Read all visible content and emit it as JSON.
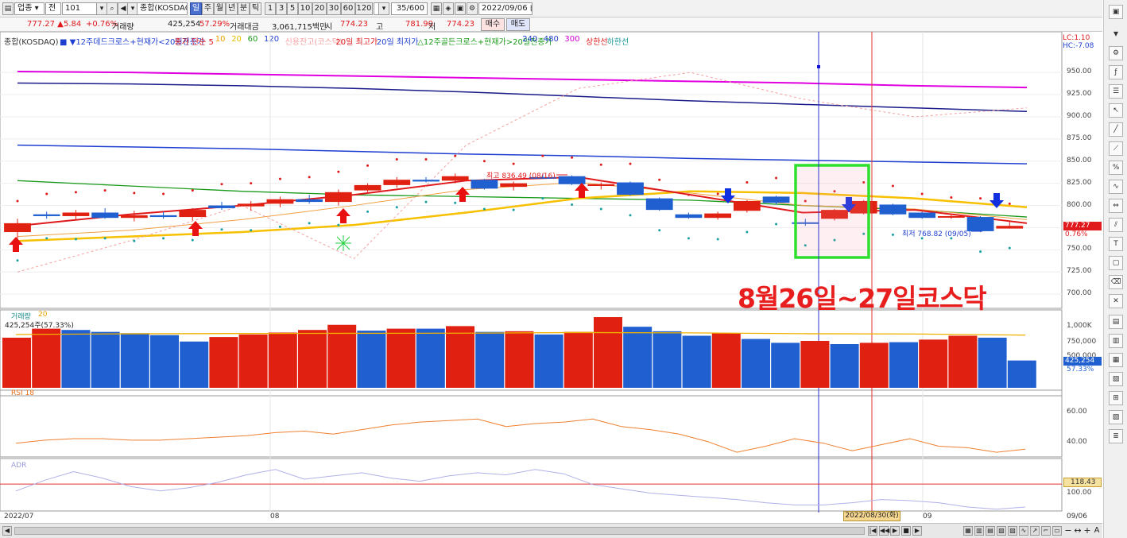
{
  "toolbar": {
    "market_select": "업종",
    "cb_label": "전",
    "code": "101",
    "name": "종합(KOSDAQ)",
    "period_tabs": [
      "일",
      "주",
      "월",
      "년",
      "분",
      "틱"
    ],
    "minute_tabs": [
      "1",
      "3",
      "5",
      "10",
      "20",
      "30",
      "60",
      "120"
    ],
    "count": "35/600",
    "date": "2022/09/06"
  },
  "quote": {
    "price": "777.27 ▲",
    "change": "5.84",
    "change_pct": "+0.76%",
    "volume_label": "거래량",
    "volume": "425,254",
    "volume_pct": "57.29%",
    "amount_label": "거래대금",
    "amount": "3,061,715백만",
    "open_label": "시",
    "open": "774.23",
    "high_label": "고",
    "high": "781.90",
    "low_label": "저",
    "low": "774.23",
    "buy_btn": "매수",
    "sell_btn": "매도"
  },
  "legend": [
    {
      "text": "종합(KOSDAQ)",
      "color": "#333333"
    },
    {
      "text": "■ ▼12주데드크로스+현재가<20일전종가",
      "color": "#1f3fd0"
    },
    {
      "text": "종가 단순 5",
      "color": "#e0191c"
    },
    {
      "text": "10",
      "color": "#f0a000"
    },
    {
      "text": "20",
      "color": "#e8c000"
    },
    {
      "text": "60",
      "color": "#1a9a1a"
    },
    {
      "text": "120",
      "color": "#1f3fd0"
    },
    {
      "text": "신용잔고(코스닥)",
      "color": "#f3a0a0"
    },
    {
      "text": "20일 최고가",
      "color": "#e0191c"
    },
    {
      "text": "20일 최저가",
      "color": "#1f3fd0"
    },
    {
      "text": "△12주골든크로스+현재가>20일전종가",
      "color": "#1a9a1a"
    },
    {
      "text": "240",
      "color": "#1f3fd0"
    },
    {
      "text": "480",
      "color": "#1f3fd0"
    },
    {
      "text": "300",
      "color": "#d000d0"
    },
    {
      "text": "상한선",
      "color": "#e0191c"
    },
    {
      "text": "하한선",
      "color": "#1a9a9a"
    }
  ],
  "corner": {
    "lc": "LC:1.10",
    "hc": "HC:-7.08"
  },
  "price_axis": [
    "950.00",
    "925.00",
    "900.00",
    "875.00",
    "850.00",
    "825.00",
    "800.00",
    "775.00",
    "750.00",
    "725.00",
    "700.00"
  ],
  "price_tag": {
    "value": "777.27",
    "pct": "0.76%"
  },
  "high_annot": "최고 836.49 (08/16)",
  "low_annot": "최저 768.82 (09/05)",
  "overlay_text": "8월26일~27일코스닥",
  "volume_panel": {
    "title": "거래량",
    "period": "20",
    "info": "425,254주(57.33%)",
    "axis": [
      "1,000K",
      "750,000",
      "500,000"
    ],
    "tag_value": "425,254",
    "tag_pct": "57.33%"
  },
  "rsi_panel": {
    "title": "RSI 18",
    "axis": [
      "60.00",
      "40.00"
    ]
  },
  "adr_panel": {
    "title": "ADR",
    "axis": [
      "100.00"
    ],
    "tag": "118.43"
  },
  "date_axis": {
    "left": "2022/07",
    "aug": "08",
    "sep": "09",
    "right": "09/06",
    "cursor": "2022/08/30(화)"
  },
  "chart_data": {
    "type": "candlestick",
    "candles": [
      {
        "o": 770,
        "h": 785,
        "l": 760,
        "c": 780,
        "dir": "up"
      },
      {
        "o": 790,
        "h": 793,
        "l": 785,
        "c": 788,
        "dir": "down"
      },
      {
        "o": 788,
        "h": 795,
        "l": 784,
        "c": 792,
        "dir": "up"
      },
      {
        "o": 792,
        "h": 797,
        "l": 785,
        "c": 786,
        "dir": "down"
      },
      {
        "o": 786,
        "h": 794,
        "l": 782,
        "c": 789,
        "dir": "up"
      },
      {
        "o": 789,
        "h": 793,
        "l": 785,
        "c": 787,
        "dir": "down"
      },
      {
        "o": 787,
        "h": 797,
        "l": 783,
        "c": 795,
        "dir": "up"
      },
      {
        "o": 800,
        "h": 804,
        "l": 795,
        "c": 797,
        "dir": "down"
      },
      {
        "o": 799,
        "h": 805,
        "l": 794,
        "c": 802,
        "dir": "up"
      },
      {
        "o": 802,
        "h": 810,
        "l": 798,
        "c": 807,
        "dir": "up"
      },
      {
        "o": 807,
        "h": 812,
        "l": 802,
        "c": 804,
        "dir": "down"
      },
      {
        "o": 804,
        "h": 818,
        "l": 800,
        "c": 815,
        "dir": "up"
      },
      {
        "o": 817,
        "h": 825,
        "l": 815,
        "c": 823,
        "dir": "up"
      },
      {
        "o": 823,
        "h": 832,
        "l": 820,
        "c": 829,
        "dir": "up"
      },
      {
        "o": 829,
        "h": 832,
        "l": 826,
        "c": 827,
        "dir": "down"
      },
      {
        "o": 828,
        "h": 836,
        "l": 825,
        "c": 833,
        "dir": "up"
      },
      {
        "o": 829,
        "h": 830,
        "l": 818,
        "c": 819,
        "dir": "down"
      },
      {
        "o": 821,
        "h": 827,
        "l": 817,
        "c": 825,
        "dir": "up"
      },
      {
        "o": 832,
        "h": 836,
        "l": 830,
        "c": 832,
        "dir": "down"
      },
      {
        "o": 833,
        "h": 834,
        "l": 823,
        "c": 824,
        "dir": "down"
      },
      {
        "o": 822,
        "h": 826,
        "l": 818,
        "c": 824,
        "dir": "up"
      },
      {
        "o": 826,
        "h": 827,
        "l": 811,
        "c": 812,
        "dir": "down"
      },
      {
        "o": 808,
        "h": 809,
        "l": 794,
        "c": 795,
        "dir": "down"
      },
      {
        "o": 790,
        "h": 792,
        "l": 785,
        "c": 786,
        "dir": "down"
      },
      {
        "o": 786,
        "h": 793,
        "l": 784,
        "c": 791,
        "dir": "up"
      },
      {
        "o": 794,
        "h": 806,
        "l": 792,
        "c": 805,
        "dir": "up"
      },
      {
        "o": 810,
        "h": 811,
        "l": 801,
        "c": 803,
        "dir": "down"
      },
      {
        "o": 780,
        "h": 785,
        "l": 777,
        "c": 781,
        "dir": "down"
      },
      {
        "o": 785,
        "h": 796,
        "l": 783,
        "c": 795,
        "dir": "up"
      },
      {
        "o": 791,
        "h": 806,
        "l": 790,
        "c": 805,
        "dir": "up"
      },
      {
        "o": 801,
        "h": 802,
        "l": 789,
        "c": 790,
        "dir": "down"
      },
      {
        "o": 792,
        "h": 793,
        "l": 785,
        "c": 786,
        "dir": "down"
      },
      {
        "o": 787,
        "h": 789,
        "l": 785,
        "c": 788,
        "dir": "up"
      },
      {
        "o": 787,
        "h": 788,
        "l": 770,
        "c": 771,
        "dir": "down"
      },
      {
        "o": 774,
        "h": 782,
        "l": 774,
        "c": 777,
        "dir": "up"
      }
    ],
    "volume_k": [
      780,
      920,
      900,
      870,
      850,
      820,
      720,
      790,
      830,
      860,
      900,
      980,
      890,
      920,
      920,
      960,
      870,
      880,
      830,
      870,
      1100,
      950,
      880,
      810,
      850,
      760,
      700,
      730,
      680,
      700,
      710,
      750,
      810,
      780,
      425
    ],
    "volume_dir": [
      "up",
      "up",
      "down",
      "down",
      "down",
      "down",
      "down",
      "up",
      "up",
      "up",
      "up",
      "up",
      "down",
      "up",
      "down",
      "up",
      "down",
      "up",
      "down",
      "up",
      "up",
      "down",
      "down",
      "down",
      "up",
      "down",
      "down",
      "up",
      "down",
      "up",
      "down",
      "up",
      "up",
      "down",
      "down"
    ],
    "rsi": [
      47,
      49,
      50,
      50,
      49,
      49,
      50,
      51,
      52,
      54,
      55,
      53,
      56,
      59,
      61,
      62,
      63,
      58,
      60,
      61,
      63,
      58,
      56,
      53,
      48,
      41,
      45,
      50,
      47,
      42,
      46,
      50,
      45,
      44,
      41,
      43
    ],
    "adr": [
      112,
      122,
      130,
      124,
      116,
      112,
      115,
      120,
      127,
      132,
      123,
      126,
      129,
      124,
      121,
      126,
      129,
      127,
      132,
      128,
      118,
      114,
      110,
      108,
      106,
      104,
      101,
      99,
      99,
      101,
      104,
      103,
      101,
      97,
      95,
      97
    ]
  }
}
